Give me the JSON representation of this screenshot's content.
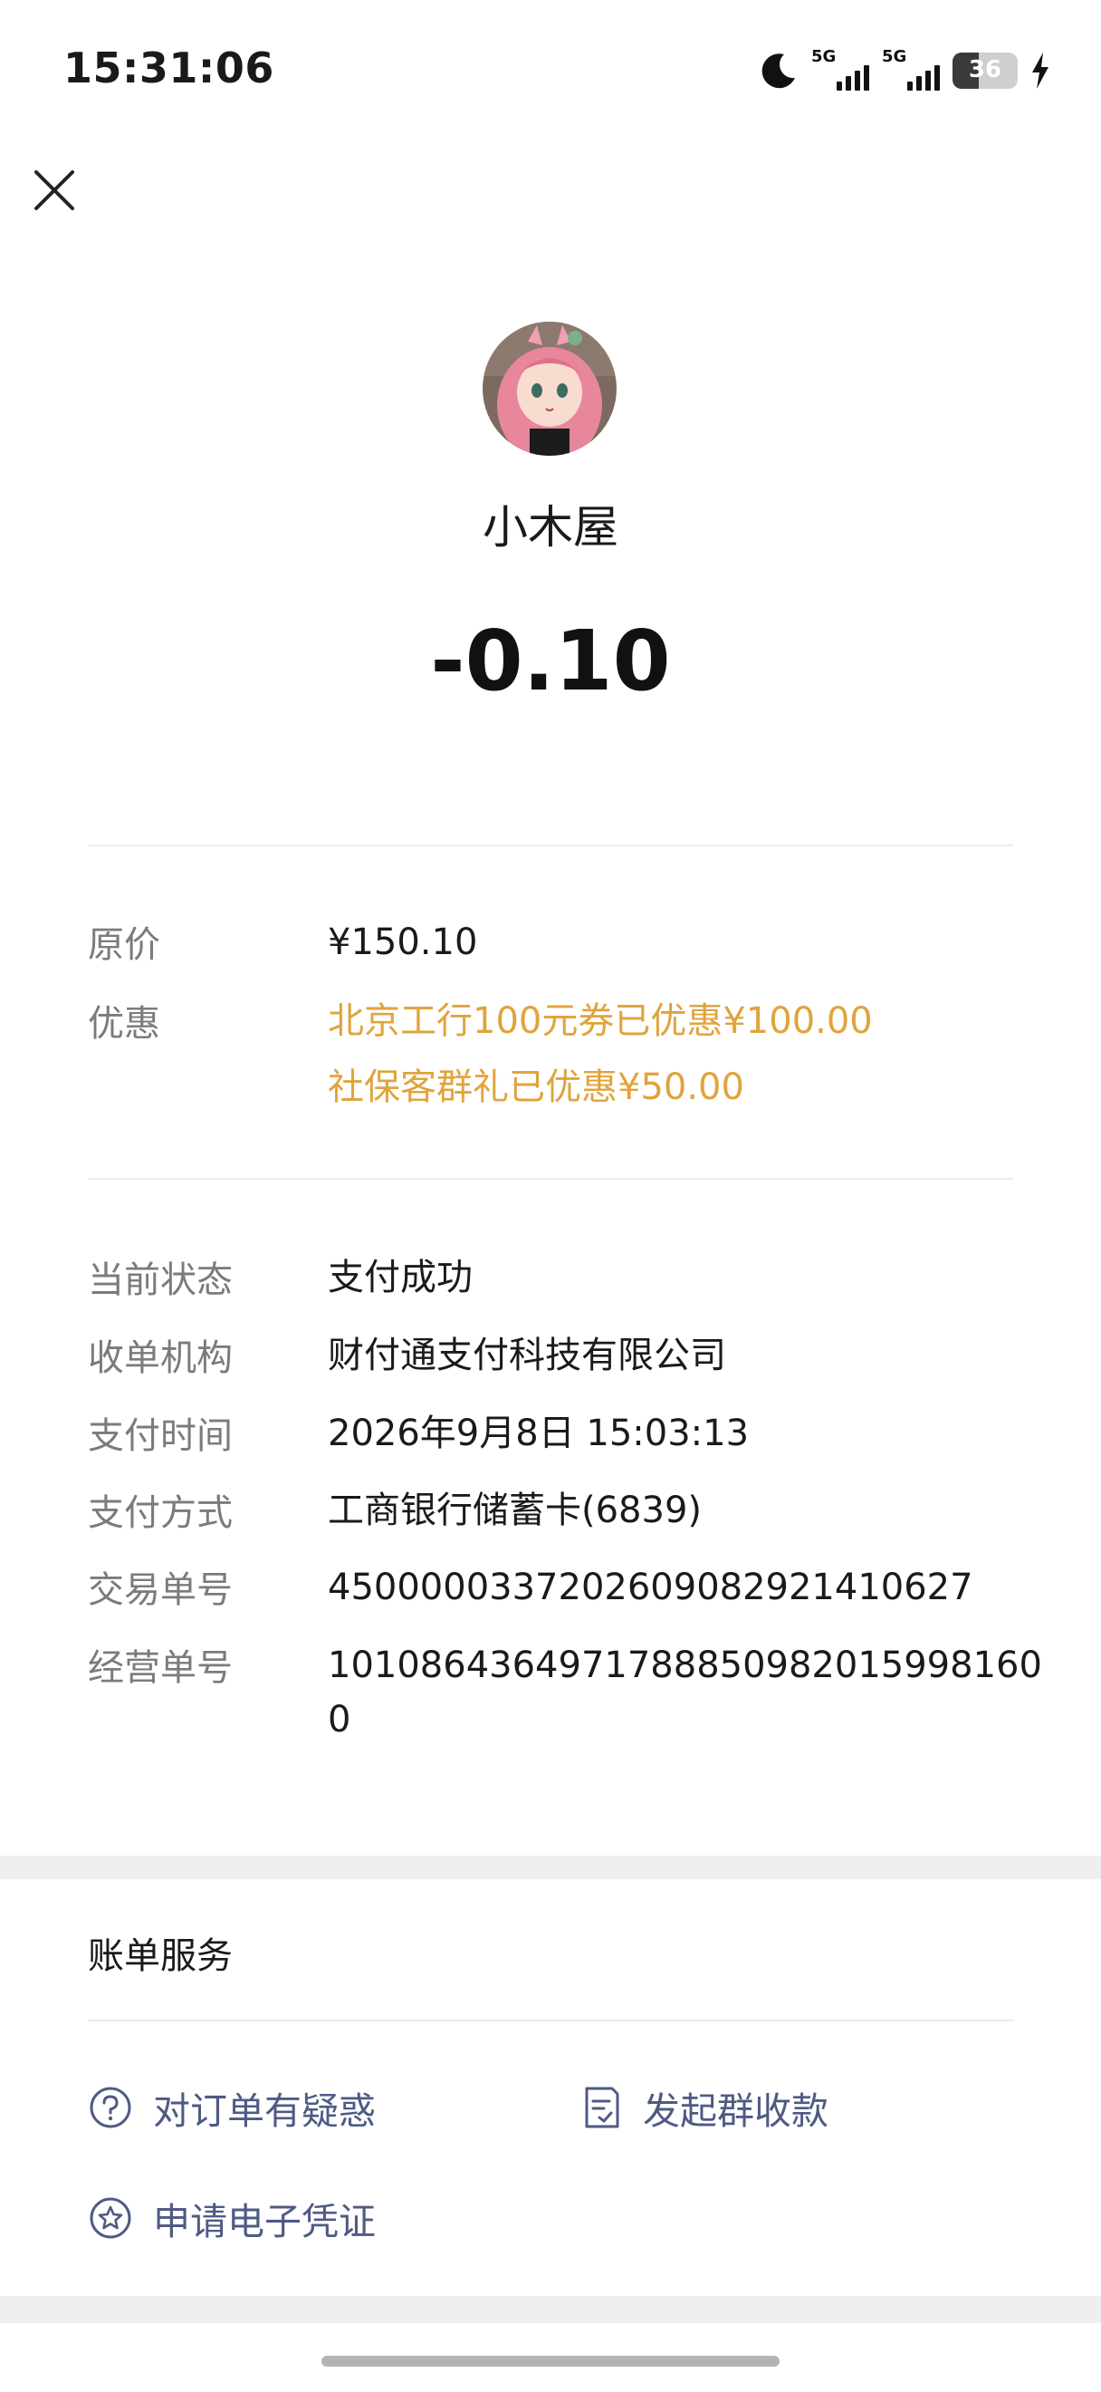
{
  "status_bar": {
    "time": "15:31:06",
    "sim1": "5G",
    "sim2": "5G",
    "battery": "36"
  },
  "merchant": {
    "name": "小木屋"
  },
  "amount": "-0.10",
  "pricing": {
    "original_label": "原价",
    "original_value": "¥150.10",
    "discount_label": "优惠",
    "discounts": [
      "北京工行100元券已优惠¥100.00",
      "社保客群礼已优惠¥50.00"
    ]
  },
  "details": [
    {
      "label": "当前状态",
      "value": "支付成功"
    },
    {
      "label": "收单机构",
      "value": "财付通支付科技有限公司"
    },
    {
      "label": "支付时间",
      "value": "2026年9月8日 15:03:13"
    },
    {
      "label": "支付方式",
      "value": "工商银行储蓄卡(6839)"
    },
    {
      "label": "交易单号",
      "value": "4500000337202609082921410627"
    },
    {
      "label": "经营单号",
      "value": "1010864364971788850982015998160",
      "value_line2": "0"
    }
  ],
  "services": {
    "title": "账单服务",
    "items": [
      {
        "label": "对订单有疑惑",
        "icon": "question-circle-icon"
      },
      {
        "label": "发起群收款",
        "icon": "receipt-icon"
      },
      {
        "label": "申请电子凭证",
        "icon": "star-badge-icon"
      }
    ]
  },
  "colors": {
    "discount": "#e0a43c",
    "link": "#4f5a84",
    "label": "#7b7b7b"
  }
}
